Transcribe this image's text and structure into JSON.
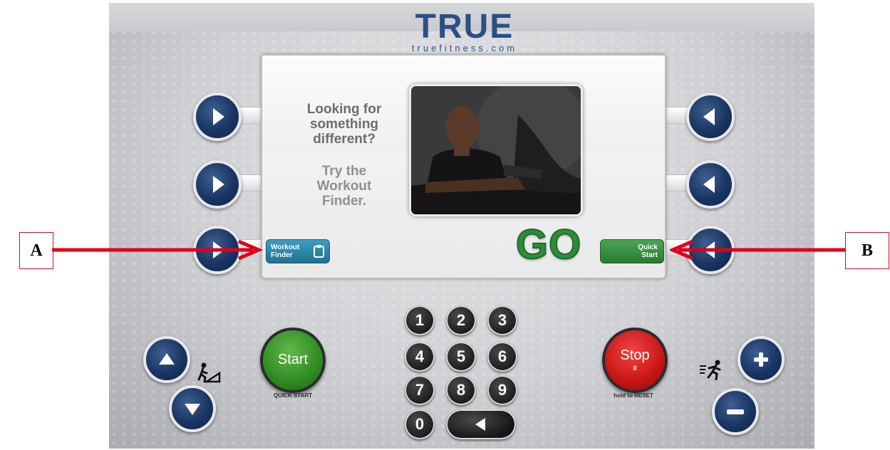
{
  "brand": {
    "name": "TRUE",
    "url": "truefitness.com"
  },
  "screen": {
    "prompt_question": [
      "Looking for",
      "something",
      "different?"
    ],
    "prompt_try": [
      "Try the",
      "Workout",
      "Finder."
    ],
    "go_text": "GO",
    "workout_finder_button": [
      "Workout",
      "Finder"
    ],
    "quick_start_button": [
      "Quick",
      "Start"
    ]
  },
  "keypad": {
    "keys": [
      "1",
      "2",
      "3",
      "4",
      "5",
      "6",
      "7",
      "8",
      "9",
      "0"
    ]
  },
  "controls": {
    "start_label": "Start",
    "start_caption": "QUICK START",
    "stop_label": "Stop",
    "stop_symbol": "II",
    "stop_caption": "hold to RESET"
  },
  "callouts": {
    "left_label": "A",
    "right_label": "B"
  },
  "colors": {
    "brand_blue": "#2b4f86",
    "go_green": "#2e8b3a",
    "workout_finder_blue": "#21718f",
    "quick_start_green": "#2c7a34",
    "callout_red": "#e0001b",
    "start_green": "#2e8b22",
    "stop_red": "#c61515"
  }
}
